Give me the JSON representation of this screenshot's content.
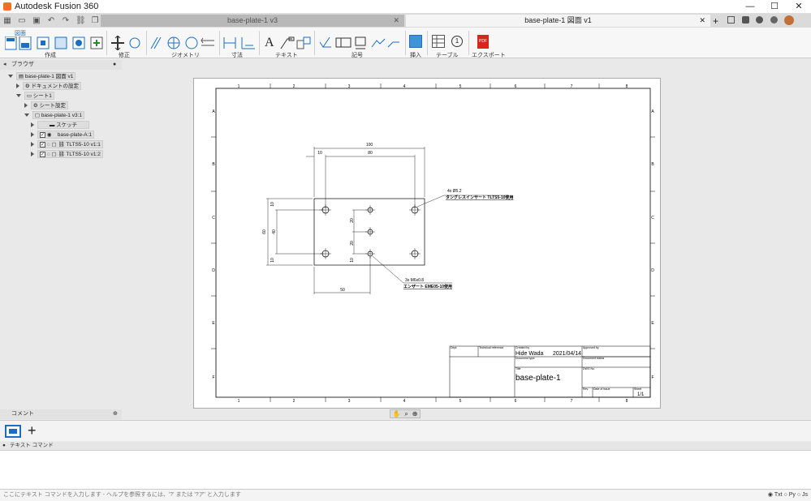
{
  "app": {
    "title": "Autodesk Fusion 360"
  },
  "tabs": [
    {
      "label": "base-plate-1 v3"
    },
    {
      "label": "base-plate-1 図面 v1"
    }
  ],
  "toolbar": {
    "mode_label": "図面",
    "groups": {
      "create": "作成",
      "modify": "修正",
      "geometry": "ジオメトリ",
      "dimensions": "寸法",
      "text": "テキスト",
      "symbols": "記号",
      "insert": "挿入",
      "table": "テーブル",
      "export": "エクスポート"
    },
    "text_glyph": "A",
    "balloon_glyph": "1",
    "pdf_glyph": "PDF"
  },
  "browser": {
    "header": "ブラウザ",
    "items": [
      {
        "label": "base-plate-1 図面 v1"
      },
      {
        "label": "ドキュメントの設定"
      },
      {
        "label": "シート1"
      },
      {
        "label": "シート設定"
      },
      {
        "label": "base-plate-1 v3:1"
      },
      {
        "label": "スケッチ"
      },
      {
        "label": "base-plate-A:1"
      },
      {
        "label": "TLTS5-10 v1:1"
      },
      {
        "label": "TLTS5-10 v1:2"
      }
    ]
  },
  "drawing": {
    "col_labels": [
      "1",
      "2",
      "3",
      "4",
      "5",
      "6",
      "7",
      "8"
    ],
    "row_labels": [
      "A",
      "B",
      "C",
      "D",
      "E",
      "F"
    ],
    "dims": {
      "width_total": "100",
      "offset_left": "10",
      "hole_spacing_x": "80",
      "height_total": "60",
      "hole_spacing_y": "40",
      "bottom_offset": "50",
      "r_top": "10",
      "r_mid": "20",
      "r_mid2": "20",
      "r_bottom": "10",
      "left_top": "10",
      "left_bottom": "10"
    },
    "note1_line1": "4x Ø5.2",
    "note1_line2": "タングレスインサート TLTS5-10使用",
    "note2_line1": "3x M6x0.8",
    "note2_line2": "エンザート EME05-10使用",
    "titleblock": {
      "dept_label": "Dept.",
      "tech_ref_label": "Technical reference",
      "created_by_label": "Created by",
      "created_by": "Hide Wada",
      "created_date": "2021/04/14",
      "approved_by_label": "Approved by",
      "doc_type_label": "Document type",
      "doc_status_label": "Document status",
      "title_label": "Title",
      "title": "base-plate-1",
      "dwg_no_label": "DWG No.",
      "rev_label": "Rev.",
      "date_issue_label": "Date of issue",
      "sheet_label": "Sheet",
      "sheet": "1/1"
    }
  },
  "comment": {
    "header": "コメント"
  },
  "textcmd": {
    "header": "テキスト コマンド"
  },
  "status": {
    "placeholder": "ここにテキスト コマンドを入力します - ヘルプを参照するには、'?' または '?ア' と入力します",
    "radio_txt": "Txt",
    "radio_py": "Py",
    "radio_js": "Js"
  }
}
